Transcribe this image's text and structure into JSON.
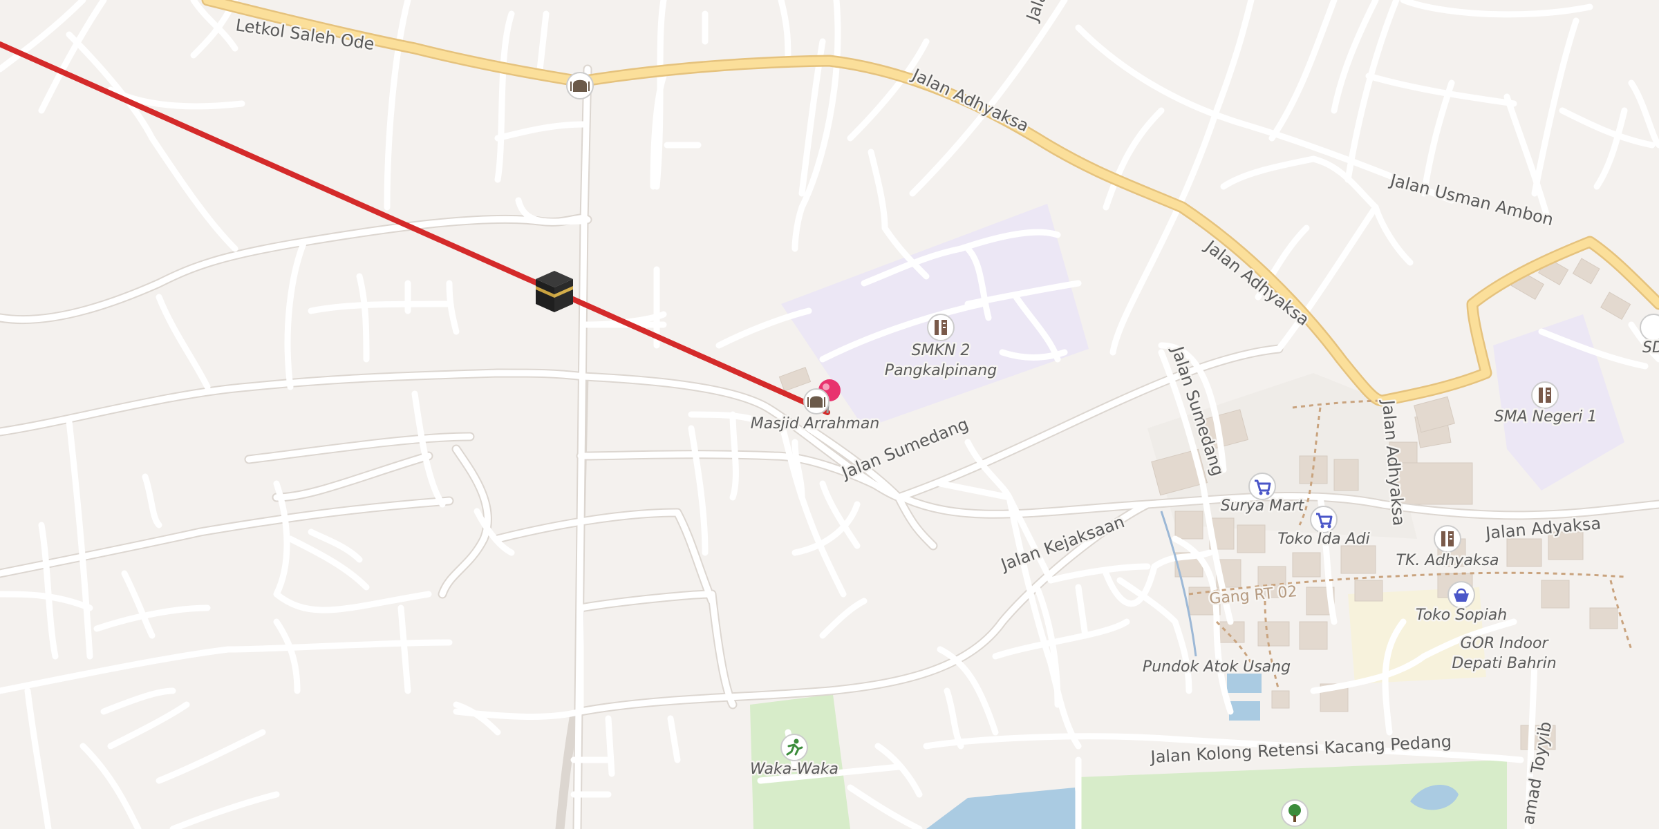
{
  "roads": {
    "jalan_adhyaksa": "Jalan Adhyaksa",
    "jalan_adhyaksa_2": "Jalan Adhyaksa",
    "jalan_adhyaksa_vertical": "Jalan Adhyaksa",
    "jalan_usman_ambon": "Jalan Usman Ambon",
    "jalan_sumedang": "Jalan Sumedang",
    "jalan_sumedang_vertical": "Jalan Sumedang",
    "jalan_kejaksaan": "Jalan Kejaksaan",
    "jalan_adyaksa": "Jalan Adyaksa",
    "jalan_kolong": "Jalan Kolong Retensi Kacang Pedang",
    "letkol_saleh_ode": "Letkol Saleh Ode",
    "jala_top": "Jala",
    "hamad_toyyib": "amad Toyyib",
    "gang_rt02": "Gang RT 02"
  },
  "pois": {
    "smkn2": [
      "SMKN 2",
      "Pangkalpinang"
    ],
    "masjid": "Masjid Arrahman",
    "surya_mart": "Surya Mart",
    "toko_ida_adi": "Toko Ida Adi",
    "tk_adhyaksa": "TK. Adhyaksa",
    "toko_sopiah": "Toko Sopiah",
    "gor": [
      "GOR Indoor",
      "Depati Bahrin"
    ],
    "pundok": "Pundok Atok Usang",
    "waka_waka": "Waka-Waka",
    "sma1": "SMA Negeri 1",
    "sd_partial": "SD"
  },
  "colors": {
    "background": "#f2efe9",
    "minor_road": "#ffffff",
    "major_road": "#fbdf9a",
    "major_road_casing": "#e6c27a",
    "school_area": "#ede6f7",
    "park": "#d5ebc8",
    "water": "#aacbe2",
    "qibla_line": "#d42a2a",
    "pin": "#e8336e"
  },
  "icons": {
    "kaaba": "kaaba-icon",
    "location_pin": "location-pin-icon",
    "mosque": "mosque-icon",
    "school": "school-icon",
    "shop": "shopping-cart-icon",
    "basket": "shopping-basket-icon",
    "sport": "sport-icon",
    "tree": "tree-icon"
  }
}
